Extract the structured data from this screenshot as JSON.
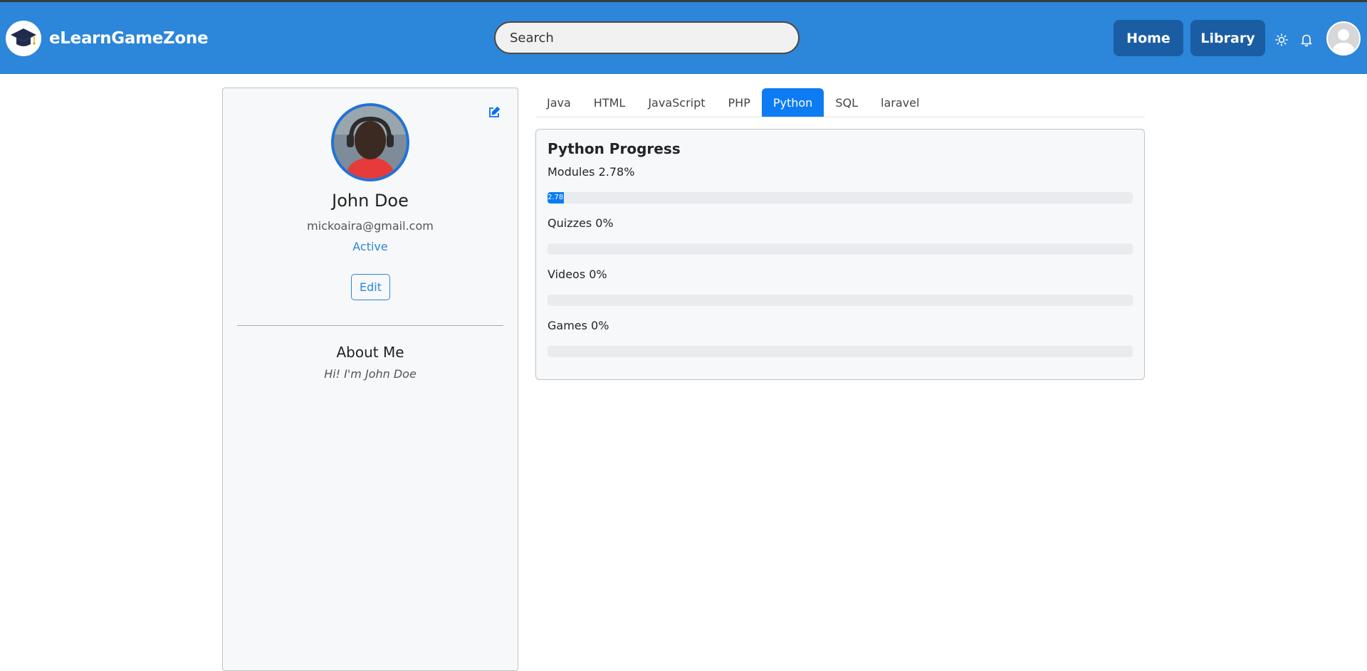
{
  "brand": {
    "name": "eLearnGameZone"
  },
  "header": {
    "search_placeholder": "Search",
    "home_label": "Home",
    "library_label": "Library",
    "accent_color": "#2c86d9"
  },
  "profile": {
    "name": "John Doe",
    "email": "mickoaira@gmail.com",
    "status": "Active",
    "edit_label": "Edit",
    "about_title": "About Me",
    "about_text": "Hi! I'm John Doe"
  },
  "tabs": [
    {
      "label": "Java"
    },
    {
      "label": "HTML"
    },
    {
      "label": "JavaScript"
    },
    {
      "label": "PHP"
    },
    {
      "label": "Python",
      "active": true
    },
    {
      "label": "SQL"
    },
    {
      "label": "laravel"
    }
  ],
  "progress": {
    "title": "Python Progress",
    "metrics": [
      {
        "label": "Modules 2.78%",
        "value": 2.78,
        "bar_text": "2.78"
      },
      {
        "label": "Quizzes 0%",
        "value": 0,
        "bar_text": ""
      },
      {
        "label": "Videos 0%",
        "value": 0,
        "bar_text": ""
      },
      {
        "label": "Games 0%",
        "value": 0,
        "bar_text": ""
      }
    ]
  }
}
